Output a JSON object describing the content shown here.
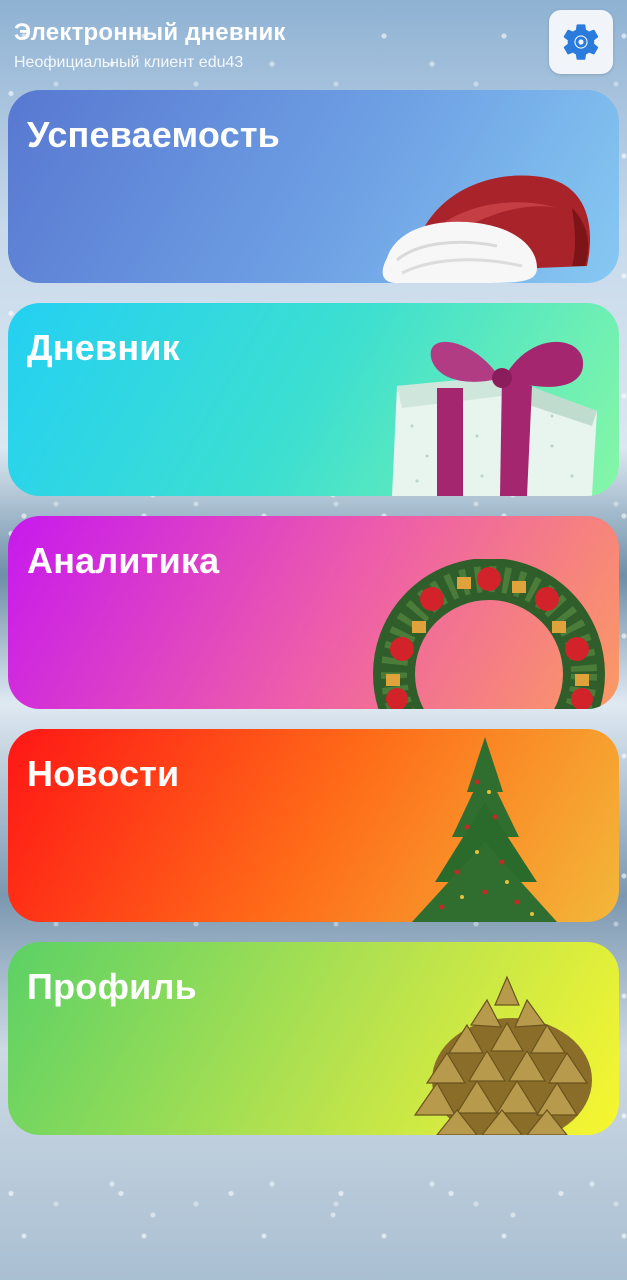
{
  "header": {
    "title": "Электронный дневник",
    "subtitle": "Неофициальный клиент edu43"
  },
  "settings": {
    "icon": "gear-icon",
    "color": "#2b7bdc"
  },
  "cards": [
    {
      "label": "Успеваемость",
      "decoration": "santa-hat"
    },
    {
      "label": "Дневник",
      "decoration": "gift-box"
    },
    {
      "label": "Аналитика",
      "decoration": "christmas-wreath"
    },
    {
      "label": "Новости",
      "decoration": "christmas-tree"
    },
    {
      "label": "Профиль",
      "decoration": "pine-cone"
    }
  ]
}
